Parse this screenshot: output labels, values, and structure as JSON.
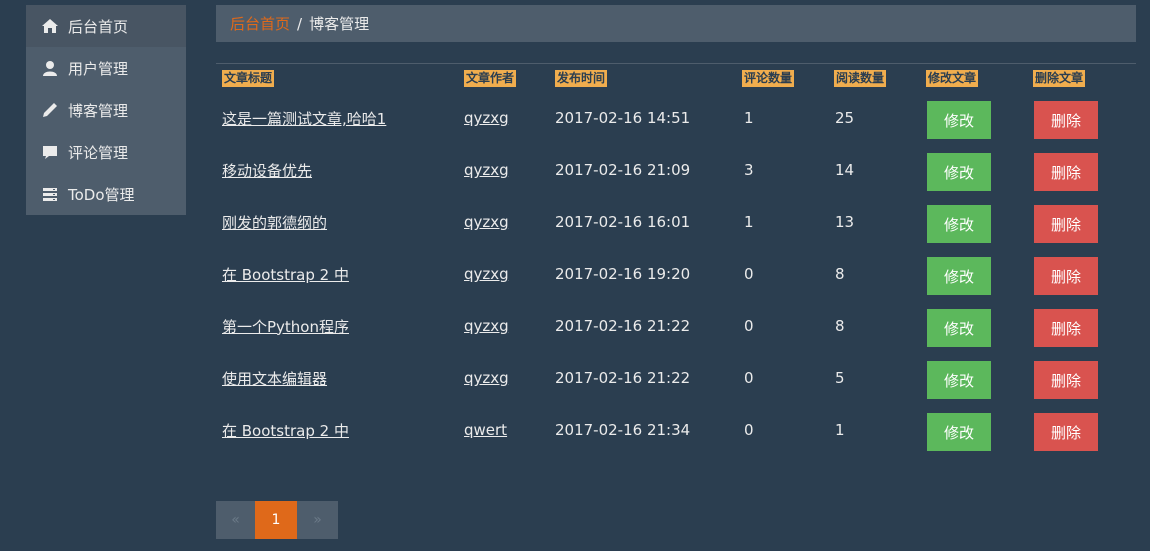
{
  "sidebar": {
    "items": [
      {
        "label": "后台首页",
        "icon": "home-icon"
      },
      {
        "label": "用户管理",
        "icon": "user-icon"
      },
      {
        "label": "博客管理",
        "icon": "pencil-icon"
      },
      {
        "label": "评论管理",
        "icon": "comment-icon"
      },
      {
        "label": "ToDo管理",
        "icon": "server-icon"
      }
    ]
  },
  "breadcrumb": {
    "home": "后台首页",
    "separator": "/",
    "current": "博客管理"
  },
  "table": {
    "headers": [
      "文章标题",
      "文章作者",
      "发布时间",
      "评论数量",
      "阅读数量",
      "修改文章",
      "删除文章"
    ],
    "edit_label": "修改",
    "delete_label": "删除",
    "rows": [
      {
        "title": "这是一篇测试文章,哈哈1",
        "author": "qyzxg",
        "time": "2017-02-16 14:51",
        "comments": "1",
        "reads": "25"
      },
      {
        "title": "移动设备优先",
        "author": "qyzxg",
        "time": "2017-02-16 21:09",
        "comments": "3",
        "reads": "14"
      },
      {
        "title": "刚发的郭德纲的",
        "author": "qyzxg",
        "time": "2017-02-16 16:01",
        "comments": "1",
        "reads": "13"
      },
      {
        "title": "在 Bootstrap 2 中",
        "author": "qyzxg",
        "time": "2017-02-16 19:20",
        "comments": "0",
        "reads": "8"
      },
      {
        "title": "第一个Python程序",
        "author": "qyzxg",
        "time": "2017-02-16 21:22",
        "comments": "0",
        "reads": "8"
      },
      {
        "title": "使用文本编辑器",
        "author": "qyzxg",
        "time": "2017-02-16 21:22",
        "comments": "0",
        "reads": "5"
      },
      {
        "title": "在 Bootstrap 2 中",
        "author": "qwert",
        "time": "2017-02-16 21:34",
        "comments": "0",
        "reads": "1"
      }
    ]
  },
  "pagination": {
    "prev": "«",
    "current": "1",
    "next": "»"
  },
  "colors": {
    "background": "#2b3e50",
    "panel": "#4e5d6c",
    "accent": "#df691a",
    "header_badge": "#f0ad4e",
    "edit": "#5cb85c",
    "delete": "#d9534f"
  }
}
